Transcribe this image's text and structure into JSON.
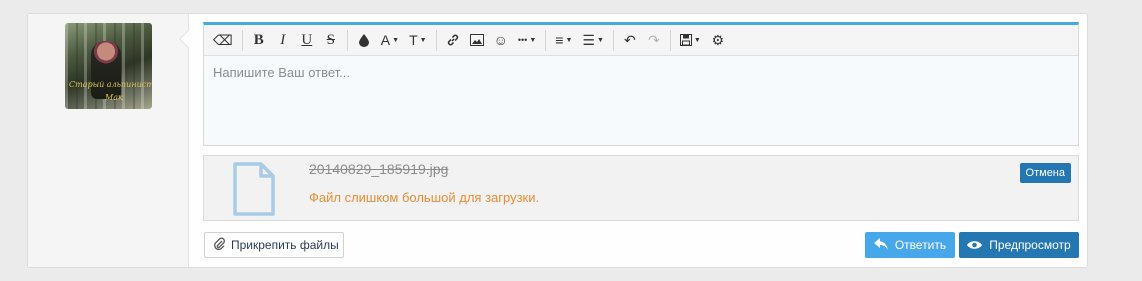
{
  "user": {
    "avatar_icon": "user-avatar-photo",
    "avatar_caption_1": "Старый альпинист",
    "avatar_caption_2": "Мак"
  },
  "editor": {
    "placeholder": "Напишите Ваш ответ...",
    "toolbar": {
      "clear": "⌫",
      "bold": "B",
      "italic": "I",
      "underline": "U",
      "strike": "S",
      "color": "●",
      "font_size": "A",
      "font_family": "T",
      "link": "⚲",
      "image": "▣",
      "smilie": "☺",
      "more": "•••",
      "align": "≡",
      "list": "☰",
      "undo": "↶",
      "redo": "↷",
      "drafts": "💾",
      "settings": "⚙"
    },
    "accent_color": "#47a7eb"
  },
  "attachment": {
    "file_name": "20140829_185919.jpg",
    "error": "Файл слишком большой для загрузки.",
    "cancel_label": "Отмена"
  },
  "actions": {
    "attach_label": "Прикрепить файлы",
    "reply_label": "Ответить",
    "preview_label": "Предпросмотр",
    "primary_color": "#2577b1",
    "secondary_color": "#47a7eb"
  }
}
